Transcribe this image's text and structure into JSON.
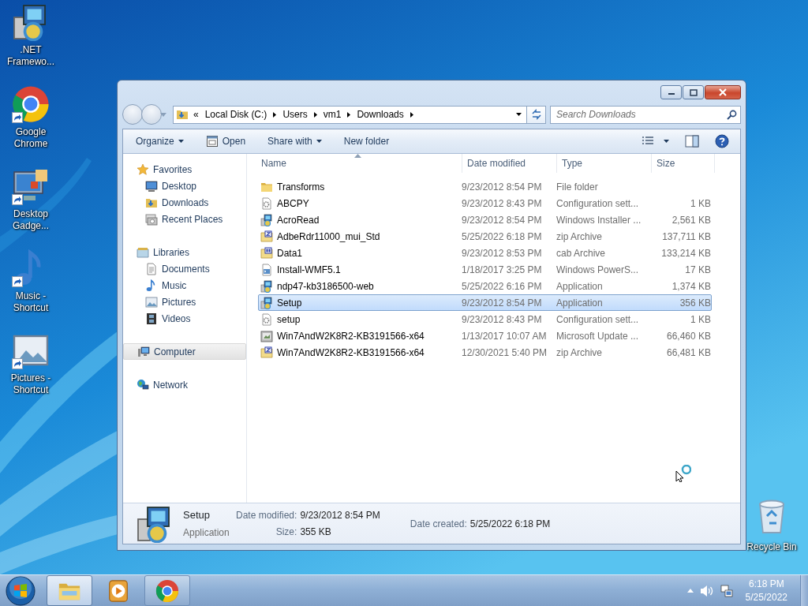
{
  "desktop_icons": [
    {
      "kind": "installer",
      "lines": [
        ".NET",
        "Framewo..."
      ],
      "shortcut": false
    },
    {
      "kind": "chrome",
      "lines": [
        "Google",
        "Chrome"
      ],
      "shortcut": true
    },
    {
      "kind": "gadgets",
      "lines": [
        "Desktop",
        "Gadge..."
      ],
      "shortcut": true
    },
    {
      "kind": "music",
      "lines": [
        "Music -",
        "Shortcut"
      ],
      "shortcut": true
    },
    {
      "kind": "pictures",
      "lines": [
        "Pictures -",
        "Shortcut"
      ],
      "shortcut": true
    }
  ],
  "recycle_bin": {
    "label": "Recycle Bin"
  },
  "explorer": {
    "address": {
      "overflow": "«",
      "crumbs": [
        "Local Disk (C:)",
        "Users",
        "vm1",
        "Downloads"
      ]
    },
    "search": {
      "placeholder": "Search Downloads"
    },
    "toolbar": [
      {
        "label": "Organize",
        "kind": "menu"
      },
      {
        "label": "Open",
        "kind": "open"
      },
      {
        "label": "Share with",
        "kind": "menu"
      },
      {
        "label": "New folder",
        "kind": "plain"
      }
    ],
    "sidebar": [
      {
        "label": "Favorites",
        "kind": "star",
        "selected": false,
        "children": [
          {
            "label": "Desktop",
            "kind": "desktop",
            "selected": false
          },
          {
            "label": "Downloads",
            "kind": "downloads",
            "selected": false
          },
          {
            "label": "Recent Places",
            "kind": "recent",
            "selected": false
          }
        ]
      },
      {
        "label": "Libraries",
        "kind": "libraries",
        "selected": false,
        "children": [
          {
            "label": "Documents",
            "kind": "documents",
            "selected": false
          },
          {
            "label": "Music",
            "kind": "music",
            "selected": false
          },
          {
            "label": "Pictures",
            "kind": "pictures",
            "selected": false
          },
          {
            "label": "Videos",
            "kind": "videos",
            "selected": false
          }
        ]
      },
      {
        "label": "Computer",
        "kind": "computer",
        "selected": true
      },
      {
        "label": "Network",
        "kind": "network",
        "selected": false
      }
    ],
    "columns": [
      {
        "label": "Name",
        "sorted": true
      },
      {
        "label": "Date modified",
        "sorted": false
      },
      {
        "label": "Type",
        "sorted": false
      },
      {
        "label": "Size",
        "sorted": false
      }
    ],
    "files": [
      {
        "name": "Transforms",
        "kind": "folder",
        "date": "9/23/2012 8:54 PM",
        "type": "File folder",
        "selected": false
      },
      {
        "name": "ABCPY",
        "kind": "settings",
        "date": "9/23/2012 8:43 PM",
        "type": "Configuration sett...",
        "size": "1 KB",
        "selected": false
      },
      {
        "name": "AcroRead",
        "kind": "installer",
        "date": "9/23/2012 8:54 PM",
        "type": "Windows Installer ...",
        "size": "2,561 KB",
        "selected": false
      },
      {
        "name": "AdbeRdr11000_mui_Std",
        "kind": "zip",
        "date": "5/25/2022 6:18 PM",
        "type": "zip Archive",
        "size": "137,711 KB",
        "selected": false
      },
      {
        "name": "Data1",
        "kind": "cab",
        "date": "9/23/2012 8:53 PM",
        "type": "cab Archive",
        "size": "133,214 KB",
        "selected": false
      },
      {
        "name": "Install-WMF5.1",
        "kind": "script",
        "date": "1/18/2017 3:25 PM",
        "type": "Windows PowerS...",
        "size": "17 KB",
        "selected": false
      },
      {
        "name": "ndp47-kb3186500-web",
        "kind": "installer",
        "date": "5/25/2022 6:16 PM",
        "type": "Application",
        "size": "1,374 KB",
        "selected": false
      },
      {
        "name": "Setup",
        "kind": "installer",
        "date": "9/23/2012 8:54 PM",
        "type": "Application",
        "size": "356 KB",
        "selected": true
      },
      {
        "name": "setup",
        "kind": "settings",
        "date": "9/23/2012 8:43 PM",
        "type": "Configuration sett...",
        "size": "1 KB",
        "selected": false
      },
      {
        "name": "Win7AndW2K8R2-KB3191566-x64",
        "kind": "update",
        "date": "1/13/2017 10:07 AM",
        "type": "Microsoft Update ...",
        "size": "66,460 KB",
        "selected": false
      },
      {
        "name": "Win7AndW2K8R2-KB3191566-x64",
        "kind": "zip",
        "date": "12/30/2021 5:40 PM",
        "type": "zip Archive",
        "size": "66,481 KB",
        "selected": false
      }
    ],
    "details": {
      "kind": "installer",
      "name": "Setup",
      "type": "Application",
      "field_columns": [
        [
          {
            "label": "Date modified:",
            "value": "9/23/2012 8:54 PM"
          },
          {
            "label": "Size:",
            "value": "355 KB"
          }
        ],
        [
          {
            "label": "Date created:",
            "value": "5/25/2022 6:18 PM"
          }
        ]
      ]
    }
  },
  "taskbar": {
    "buttons": [
      {
        "kind": "explorer",
        "selected": true,
        "running": true
      },
      {
        "kind": "media",
        "selected": false,
        "running": false
      },
      {
        "kind": "chrome",
        "selected": false,
        "running": true
      }
    ],
    "clock": {
      "time": "6:18 PM",
      "date": "5/25/2022"
    }
  }
}
